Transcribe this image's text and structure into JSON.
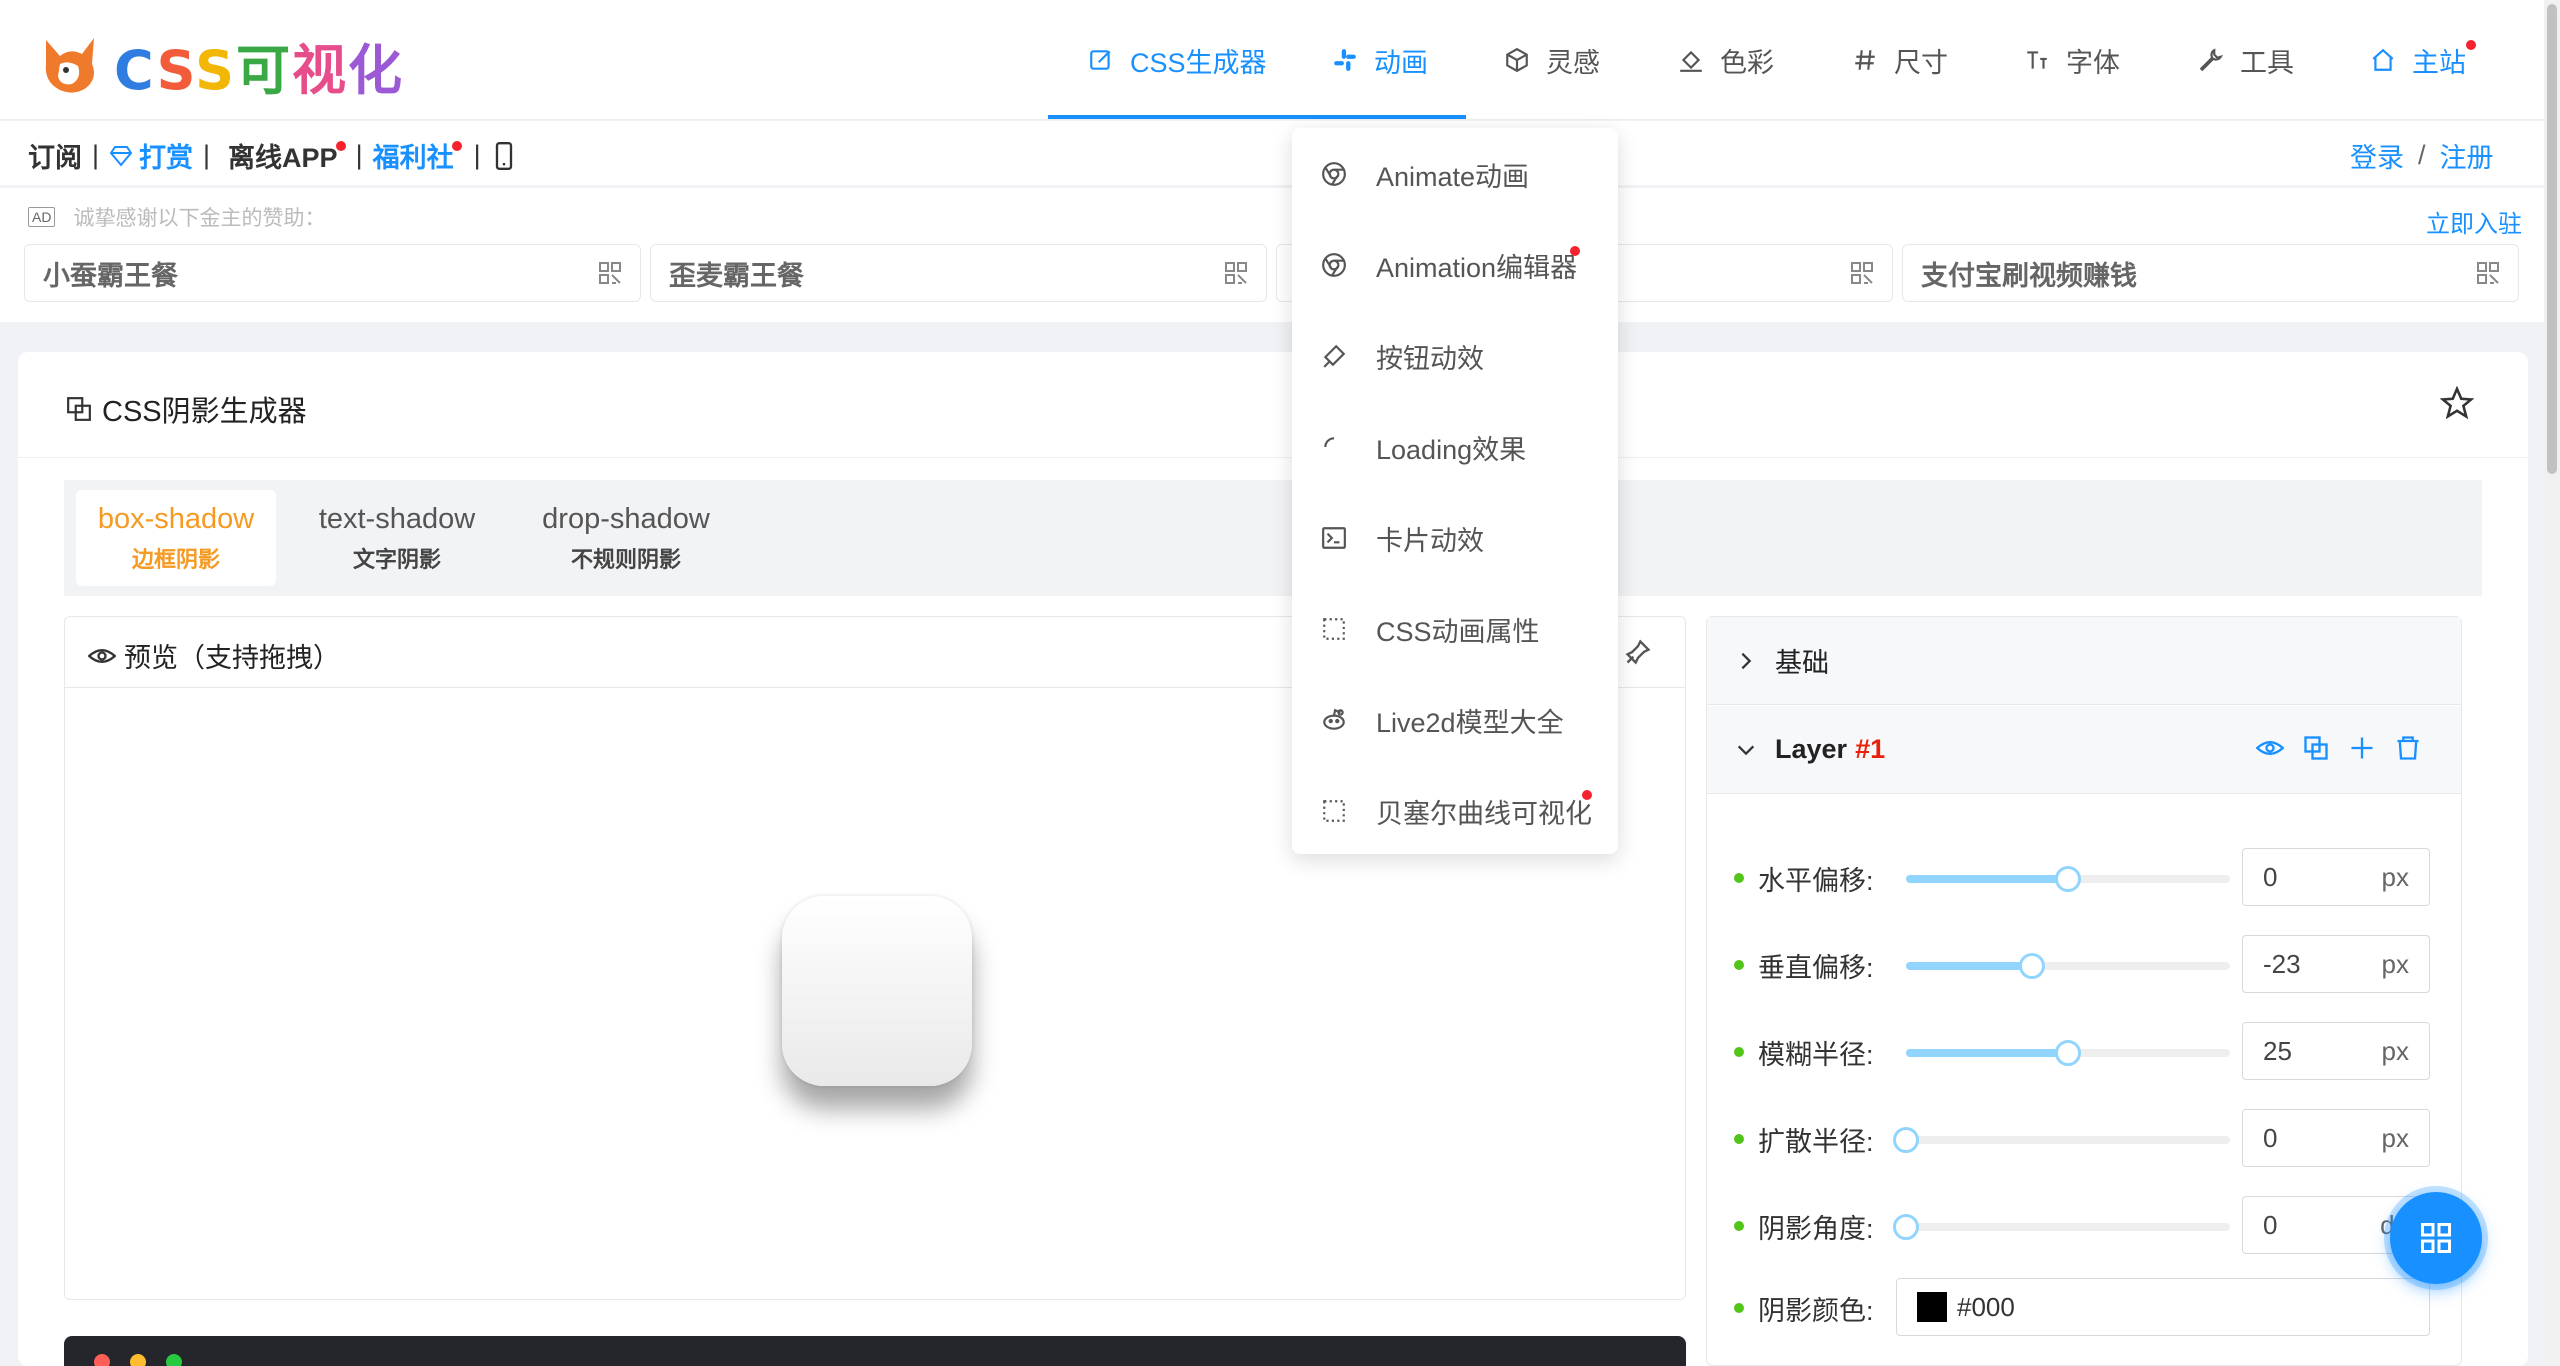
{
  "brand": {
    "title_parts": [
      {
        "text": "C",
        "color": "#2f7de1"
      },
      {
        "text": "S",
        "color": "#f25c3b"
      },
      {
        "text": "S",
        "color": "#f2b705"
      },
      {
        "text": "可",
        "color": "#39a845"
      },
      {
        "text": "视",
        "color": "#e74c8b"
      },
      {
        "text": "化",
        "color": "#9b59d6"
      }
    ]
  },
  "nav": {
    "items": [
      {
        "label": "CSS生成器",
        "icon": "edit-icon"
      },
      {
        "label": "动画",
        "icon": "slack-icon"
      },
      {
        "label": "灵感",
        "icon": "cube-icon"
      },
      {
        "label": "色彩",
        "icon": "paint-bucket-icon"
      },
      {
        "label": "尺寸",
        "icon": "hash-icon"
      },
      {
        "label": "字体",
        "icon": "font-size-icon"
      },
      {
        "label": "工具",
        "icon": "wrench-icon"
      },
      {
        "label": "主站",
        "icon": "home-icon"
      }
    ],
    "active": "动画"
  },
  "subbar": {
    "subscribe": "订阅",
    "sep": "|",
    "reward": "打赏",
    "offline_app": "离线APP",
    "welfare": "福利社",
    "login": "登录",
    "slash": "/",
    "register": "注册"
  },
  "ads": {
    "badge": "AD",
    "thanks": "诚挚感谢以下金主的赞助：",
    "join": "立即入驻",
    "cards": [
      "小蚕霸王餐",
      "歪麦霸王餐",
      "支付宝刷视频赚钱"
    ]
  },
  "page": {
    "title": "CSS阴影生成器"
  },
  "tabs": [
    {
      "label": "box-shadow",
      "sublabel": "边框阴影",
      "active": true
    },
    {
      "label": "text-shadow",
      "sublabel": "文字阴影",
      "active": false
    },
    {
      "label": "drop-shadow",
      "sublabel": "不规则阴影",
      "active": false
    }
  ],
  "preview": {
    "title": "预览（支持拖拽）"
  },
  "settings": {
    "basic": "基础",
    "layer_label": "Layer",
    "layer_num": "#1",
    "controls": [
      {
        "label": "水平偏移:",
        "value": "0",
        "unit": "px",
        "fraction": 0.5
      },
      {
        "label": "垂直偏移:",
        "value": "-23",
        "unit": "px",
        "fraction": 0.39
      },
      {
        "label": "模糊半径:",
        "value": "25",
        "unit": "px",
        "fraction": 0.5
      },
      {
        "label": "扩散半径:",
        "value": "0",
        "unit": "px",
        "fraction": 0.0
      },
      {
        "label": "阴影角度:",
        "value": "0",
        "unit": "de",
        "fraction": 0.0
      }
    ],
    "color_label": "阴影颜色:",
    "color_value": "#000"
  },
  "dropdown": {
    "items": [
      {
        "label": "Animate动画",
        "icon": "chrome-icon",
        "dot": false
      },
      {
        "label": "Animation编辑器",
        "icon": "chrome-icon",
        "dot": true
      },
      {
        "label": "按钮动效",
        "icon": "eraser-icon",
        "dot": false
      },
      {
        "label": "Loading效果",
        "icon": "loading-icon",
        "dot": false
      },
      {
        "label": "卡片动效",
        "icon": "terminal-icon",
        "dot": false
      },
      {
        "label": "CSS动画属性",
        "icon": "dotted-square-icon",
        "dot": false
      },
      {
        "label": "Live2d模型大全",
        "icon": "reddit-icon",
        "dot": false
      },
      {
        "label": "贝塞尔曲线可视化",
        "icon": "dotted-square-icon",
        "dot": true
      }
    ]
  },
  "colors": {
    "accent": "#1890ff",
    "active_tab": "#f59a23",
    "red_dot": "#f5222d",
    "green_dot": "#52c41a",
    "layer_num": "#e8200c"
  }
}
